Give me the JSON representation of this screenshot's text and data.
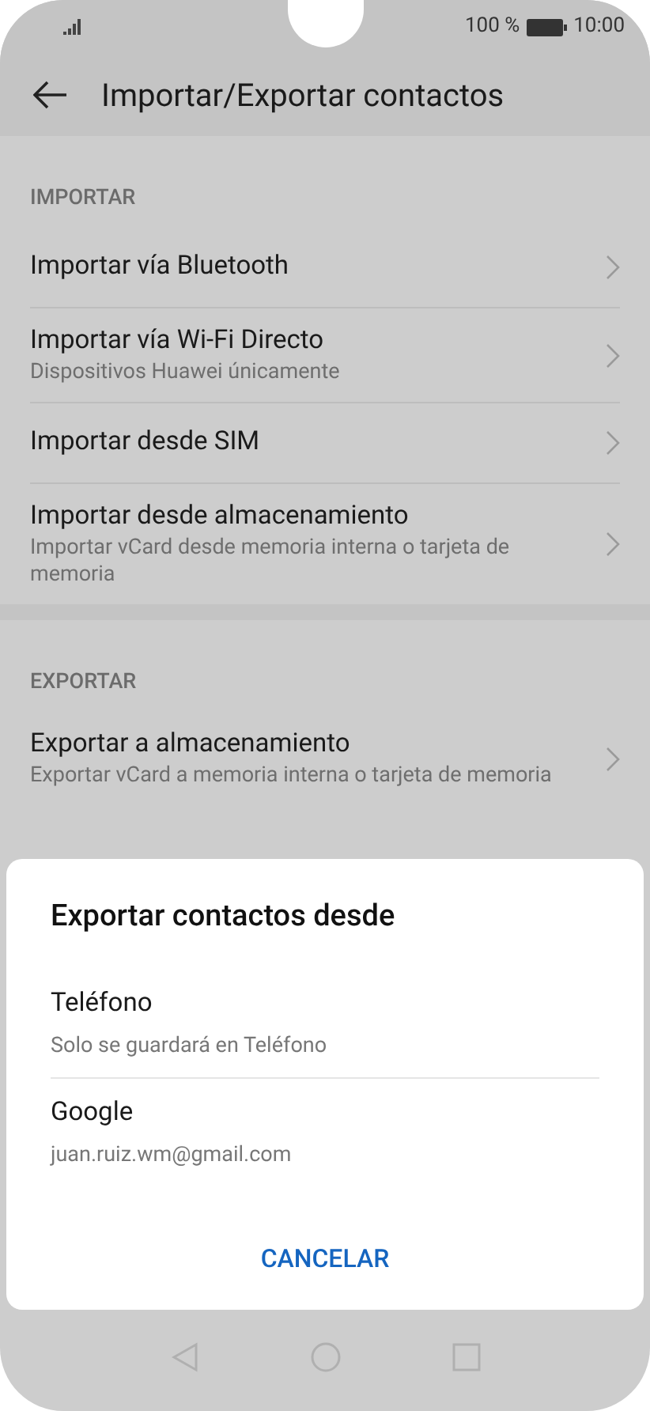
{
  "status_bar": {
    "battery": "100 %",
    "time": "10:00"
  },
  "header": {
    "title": "Importar/Exportar contactos"
  },
  "sections": [
    {
      "title": "IMPORTAR",
      "items": [
        {
          "title": "Importar vía Bluetooth"
        },
        {
          "title": "Importar vía Wi-Fi Directo",
          "subtitle": "Dispositivos Huawei únicamente"
        },
        {
          "title": "Importar desde SIM"
        },
        {
          "title": "Importar desde almacenamiento",
          "subtitle": "Importar vCard desde memoria interna o tarjeta de memoria"
        }
      ]
    },
    {
      "title": "EXPORTAR",
      "items": [
        {
          "title": "Exportar a almacenamiento",
          "subtitle": "Exportar vCard a memoria interna o tarjeta de memoria"
        }
      ]
    }
  ],
  "dialog": {
    "title": "Exportar contactos desde",
    "options": [
      {
        "title": "Teléfono",
        "subtitle": "Solo se guardará en Teléfono"
      },
      {
        "title": "Google",
        "subtitle": "juan.ruiz.wm@gmail.com"
      }
    ],
    "button": "CANCELAR"
  }
}
